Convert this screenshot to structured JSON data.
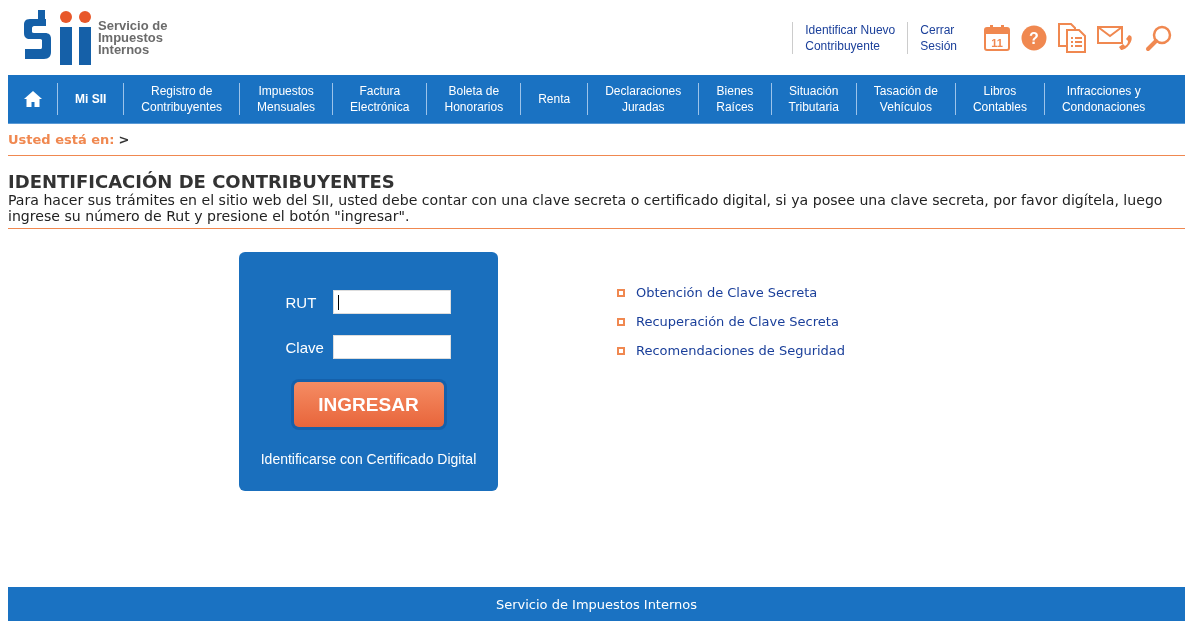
{
  "header": {
    "logo_text": [
      "Servicio de",
      "Impuestos",
      "Internos"
    ],
    "top_links": [
      {
        "lines": [
          "Identificar Nuevo",
          "Contribuyente"
        ]
      },
      {
        "lines": [
          "Cerrar",
          "Sesión"
        ]
      }
    ],
    "tool_icons": [
      {
        "kind": "calendar",
        "label": "11"
      },
      {
        "kind": "help",
        "label": "?"
      },
      {
        "kind": "documents"
      },
      {
        "kind": "contact"
      },
      {
        "kind": "search"
      }
    ]
  },
  "nav": {
    "items": [
      {
        "kind": "home"
      },
      {
        "kind": "text",
        "lines": [
          "Mi SII"
        ],
        "bold": true
      },
      {
        "kind": "text",
        "lines": [
          "Registro de",
          "Contribuyentes"
        ],
        "bold": false
      },
      {
        "kind": "text",
        "lines": [
          "Impuestos",
          "Mensuales"
        ],
        "bold": false
      },
      {
        "kind": "text",
        "lines": [
          "Factura",
          "Electrónica"
        ],
        "bold": false
      },
      {
        "kind": "text",
        "lines": [
          "Boleta de",
          "Honorarios"
        ],
        "bold": false
      },
      {
        "kind": "text",
        "lines": [
          "Renta"
        ],
        "bold": false
      },
      {
        "kind": "text",
        "lines": [
          "Declaraciones",
          "Juradas"
        ],
        "bold": false
      },
      {
        "kind": "text",
        "lines": [
          "Bienes",
          "Raíces"
        ],
        "bold": false
      },
      {
        "kind": "text",
        "lines": [
          "Situación",
          "Tributaria"
        ],
        "bold": false
      },
      {
        "kind": "text",
        "lines": [
          "Tasación de",
          "Vehículos"
        ],
        "bold": false
      },
      {
        "kind": "text",
        "lines": [
          "Libros",
          "Contables"
        ],
        "bold": false
      },
      {
        "kind": "text",
        "lines": [
          "Infracciones y",
          "Condonaciones"
        ],
        "bold": false
      }
    ]
  },
  "breadcrumb": {
    "label": "Usted está en:",
    "separator": ">"
  },
  "heading": "IDENTIFICACIÓN DE CONTRIBUYENTES",
  "intro": [
    "Para hacer sus trámites en el sitio web del SII, usted debe contar con una clave secreta o certificado digital, si ya posee una clave secreta, por favor digítela, luego",
    "ingrese su número de Rut y presione el botón \"ingresar\"."
  ],
  "login": {
    "fields": [
      {
        "label": "RUT",
        "focused": true
      },
      {
        "label": "Clave",
        "focused": false
      }
    ],
    "submit": "INGRESAR",
    "certificate_link": "Identificarse con Certificado Digital"
  },
  "links": [
    "Obtención de Clave Secreta",
    "Recuperación de Clave Secreta",
    "Recomendaciones de Seguridad"
  ],
  "footer": "Servicio de Impuestos Internos"
}
